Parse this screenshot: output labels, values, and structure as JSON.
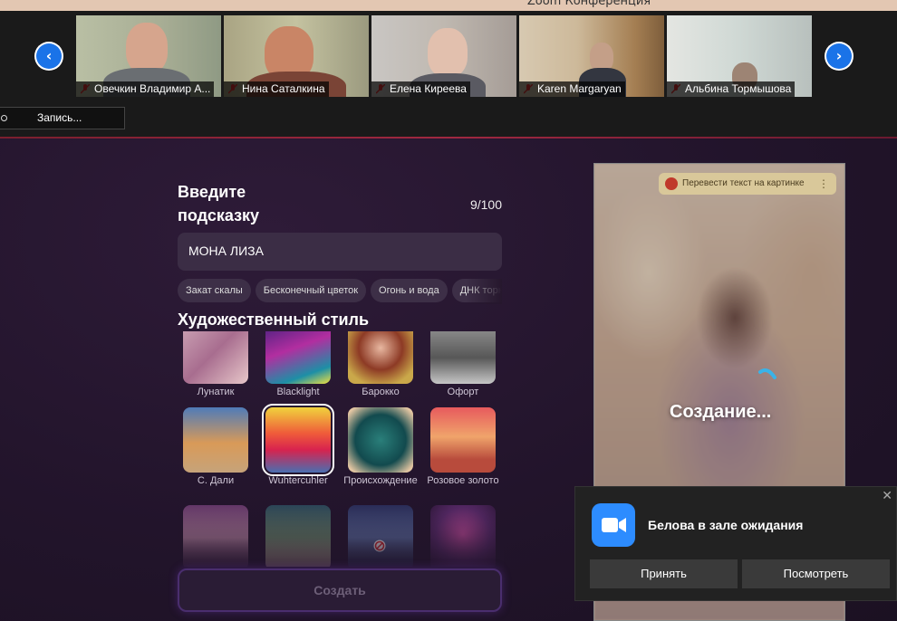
{
  "window": {
    "title": "Zoom Конференция"
  },
  "participants": [
    {
      "name": "Овечкин Владимир А..."
    },
    {
      "name": "Нина Саталкина"
    },
    {
      "name": "Елена Киреева"
    },
    {
      "name": "Karen Margaryan"
    },
    {
      "name": "Альбина Тормышова"
    }
  ],
  "recording": {
    "label": "Запись..."
  },
  "prompt": {
    "title": "Введите подсказку",
    "counter": "9/100",
    "value": "МОНА ЛИЗА",
    "chips": [
      "Закат скалы",
      "Бесконечный цветок",
      "Огонь и вода",
      "ДНК торнадо"
    ]
  },
  "art_style": {
    "title": "Художественный стиль",
    "items": [
      {
        "name": "Лунатик"
      },
      {
        "name": "Blacklight"
      },
      {
        "name": "Барокко"
      },
      {
        "name": "Офорт"
      },
      {
        "name": "С. Дали"
      },
      {
        "name": "Wuhtercuhler",
        "selected": true
      },
      {
        "name": "Происхождение"
      },
      {
        "name": "Розовое золото"
      },
      {
        "name": ""
      },
      {
        "name": ""
      },
      {
        "name": ""
      },
      {
        "name": ""
      }
    ],
    "create_label": "Создать"
  },
  "preview": {
    "translate_label": "Перевести текст на картинке",
    "status": "Создание..."
  },
  "notification": {
    "message": "Белова  в зале ожидания",
    "accept_label": "Принять",
    "view_label": "Посмотреть",
    "close_symbol": "✕"
  },
  "icons": {
    "nav_prev": "chevron-left-icon",
    "nav_next": "chevron-right-icon",
    "muted_mic": "mic-muted-icon"
  }
}
